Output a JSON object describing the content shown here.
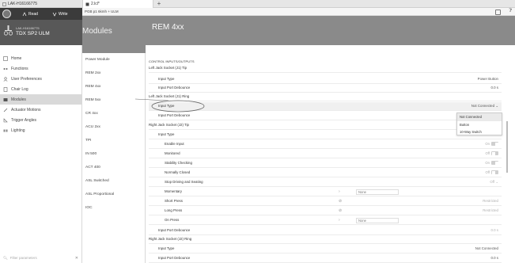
{
  "tabs": [
    {
      "label": "LAK-H16166775",
      "icon": "doc-icon"
    },
    {
      "label": "2.lcl*",
      "icon": "file-icon"
    }
  ],
  "toolbar": {
    "read_label": "Read",
    "write_label": "Write"
  },
  "device": {
    "id": "LAK-H16166775",
    "name": "TDX SP2 ULM"
  },
  "nav": [
    {
      "label": "Home",
      "icon": "home-icon"
    },
    {
      "label": "Functions",
      "icon": "functions-icon"
    },
    {
      "label": "User Preferences",
      "icon": "user-icon"
    },
    {
      "label": "Chair Log",
      "icon": "log-icon"
    },
    {
      "label": "Modules",
      "icon": "modules-icon",
      "active": true
    },
    {
      "label": "Actuator Motions",
      "icon": "actuator-icon"
    },
    {
      "label": "Trigger Angles",
      "icon": "trigger-icon"
    },
    {
      "label": "Lighting",
      "icon": "lighting-icon"
    }
  ],
  "filter_placeholder": "Filter parameters",
  "modules_top": "PGB p1 6kmh + ULM",
  "modules_title": "Modules",
  "modules": [
    "Power Module",
    "REM 2xx",
    "REM 4xx",
    "REM 5xx",
    "CR 4xx",
    "ACU 2xx",
    "TPI",
    "IN 500",
    "ACT 400",
    "ASL Switched",
    "ASL Proportional",
    "IOC"
  ],
  "main_title": "REM 4xx",
  "section_title": "CONTROL INPUTS/OUTPUTS",
  "rows": [
    {
      "label": "Left Jack Socket (J1) Tip",
      "type": "header"
    },
    {
      "label": "Input Type",
      "type": "value",
      "value": "Power Button"
    },
    {
      "label": "Input Port Debounce",
      "type": "value",
      "value": "0.0 s"
    },
    {
      "label": "Left Jack Socket (J1) Ring",
      "type": "header"
    },
    {
      "label": "Input Type",
      "type": "dropdown",
      "value": "Not Connected"
    },
    {
      "label": "Input Port Debounce",
      "type": "blank"
    },
    {
      "label": "Right Jack Socket (J2) Tip",
      "type": "header"
    },
    {
      "label": "Input Type",
      "type": "dim",
      "value": "Button"
    },
    {
      "label": "Enable Input",
      "type": "toggle",
      "value": "On"
    },
    {
      "label": "Monitored",
      "type": "toggle",
      "value": "Off"
    },
    {
      "label": "Stability Checking",
      "type": "toggle",
      "value": "On"
    },
    {
      "label": "Normally Closed",
      "type": "toggle",
      "value": "Off"
    },
    {
      "label": "Stop Driving and Seating",
      "type": "dim",
      "value": "Off"
    },
    {
      "label": "Momentary",
      "type": "none",
      "value": "None"
    },
    {
      "label": "Short Press",
      "type": "restricted",
      "value": "Restricted"
    },
    {
      "label": "Long Press",
      "type": "restricted",
      "value": "Restricted"
    },
    {
      "label": "On Press",
      "type": "none",
      "value": "None"
    },
    {
      "label": "Input Port Debounce",
      "type": "dim",
      "value": "0.0 s"
    },
    {
      "label": "Right Jack Socket (J2) Ring",
      "type": "header"
    },
    {
      "label": "Input Type",
      "type": "value",
      "value": "Not Connected"
    },
    {
      "label": "Input Port Debounce",
      "type": "value",
      "value": "0.0 s"
    }
  ],
  "dropdown_options": [
    "Not Connected",
    "Button",
    "10-Way Switch"
  ],
  "colors": {
    "header_gray": "#8a8a8a",
    "dark_panel": "#3b3b3b",
    "active_nav": "#d9d9d9"
  }
}
